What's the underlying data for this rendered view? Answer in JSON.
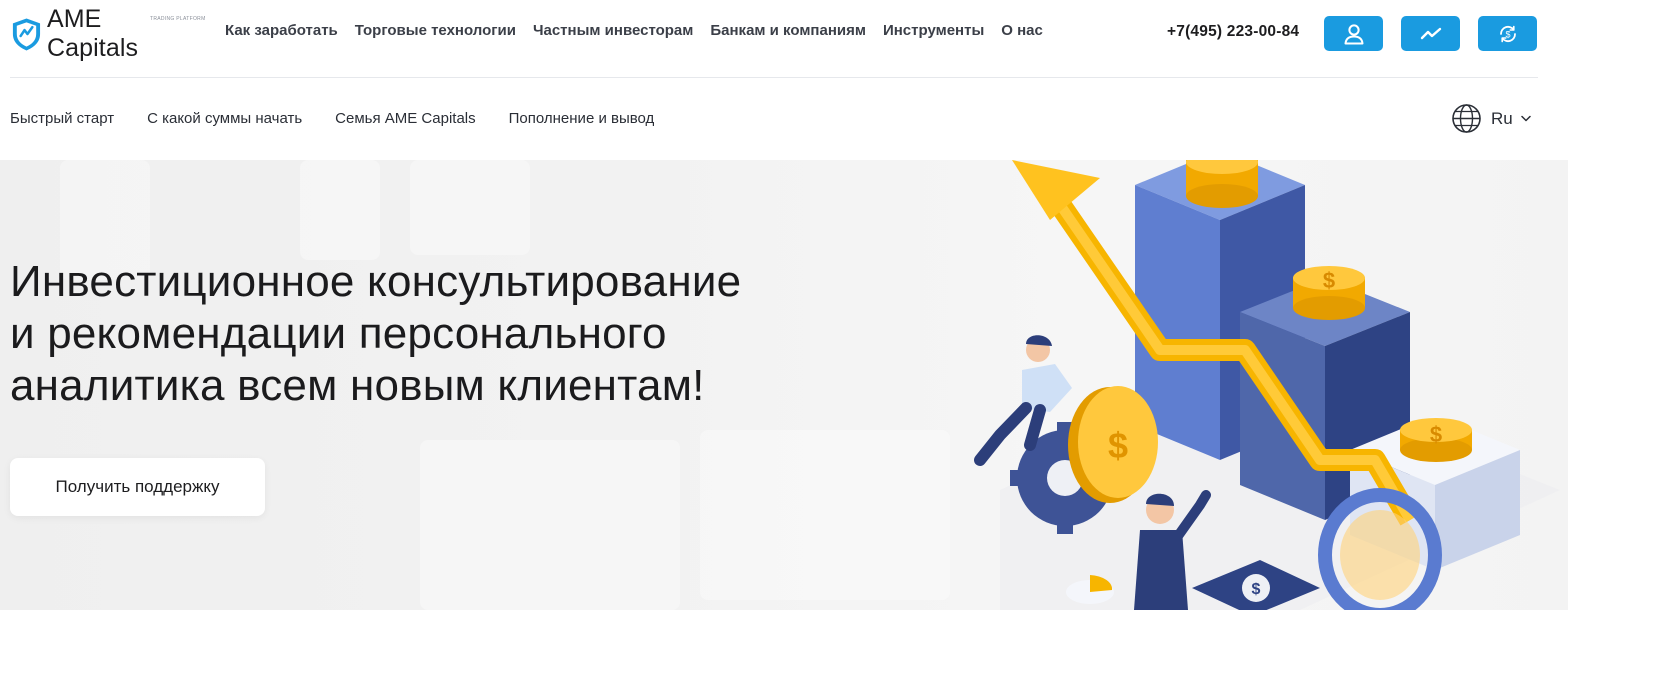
{
  "header": {
    "logo_text": "AME Capitals",
    "logo_subtext": "TRADING PLATFORM",
    "nav": [
      "Как заработать",
      "Торговые технологии",
      "Частным инвесторам",
      "Банкам и компаниям",
      "Инструменты",
      "О нас"
    ],
    "phone": "+7(495) 223-00-84",
    "buttons": [
      {
        "icon": "user-icon"
      },
      {
        "icon": "chart-trend-icon"
      },
      {
        "icon": "refresh-dollar-icon"
      }
    ]
  },
  "subnav": {
    "items": [
      "Быстрый старт",
      "С какой суммы начать",
      "Семья AME Capitals",
      "Пополнение и вывод"
    ],
    "language": "Ru",
    "language_icon": "globe-icon"
  },
  "hero": {
    "title_line1": "Инвестиционное консультирование",
    "title_line2": "и рекомендации персонального",
    "title_line3": "аналитика всем новым клиентам!",
    "button_label": "Получить поддержку"
  },
  "colors": {
    "accent": "#1a9be0",
    "text": "#1d1d1f",
    "arrow": "#f7b500",
    "blocks": "#4f6bb3"
  }
}
